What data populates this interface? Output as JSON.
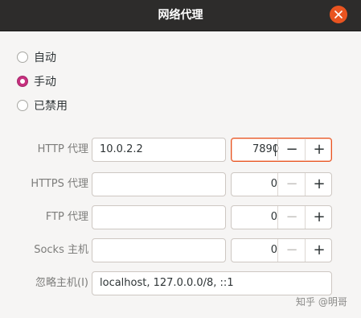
{
  "window": {
    "title": "网络代理"
  },
  "method": {
    "options": [
      {
        "label": "自动",
        "checked": false
      },
      {
        "label": "手动",
        "checked": true
      },
      {
        "label": "已禁用",
        "checked": false
      }
    ]
  },
  "rows": [
    {
      "label": "HTTP 代理",
      "host": "10.0.2.2",
      "port": "7890"
    },
    {
      "label": "HTTPS 代理",
      "host": "",
      "port": "0"
    },
    {
      "label": "FTP 代理",
      "host": "",
      "port": "0"
    },
    {
      "label": "Socks 主机",
      "host": "",
      "port": "0"
    }
  ],
  "ignore": {
    "label": "忽略主机(I)",
    "value": "localhost, 127.0.0.0/8, ::1"
  },
  "spin_buttons": {
    "minus": "−",
    "plus": "+"
  },
  "watermark": "知乎 @明哥",
  "colors": {
    "accent": "#e95420",
    "radio_checked": "#c7307f",
    "titlebar": "#2d2c2b"
  }
}
